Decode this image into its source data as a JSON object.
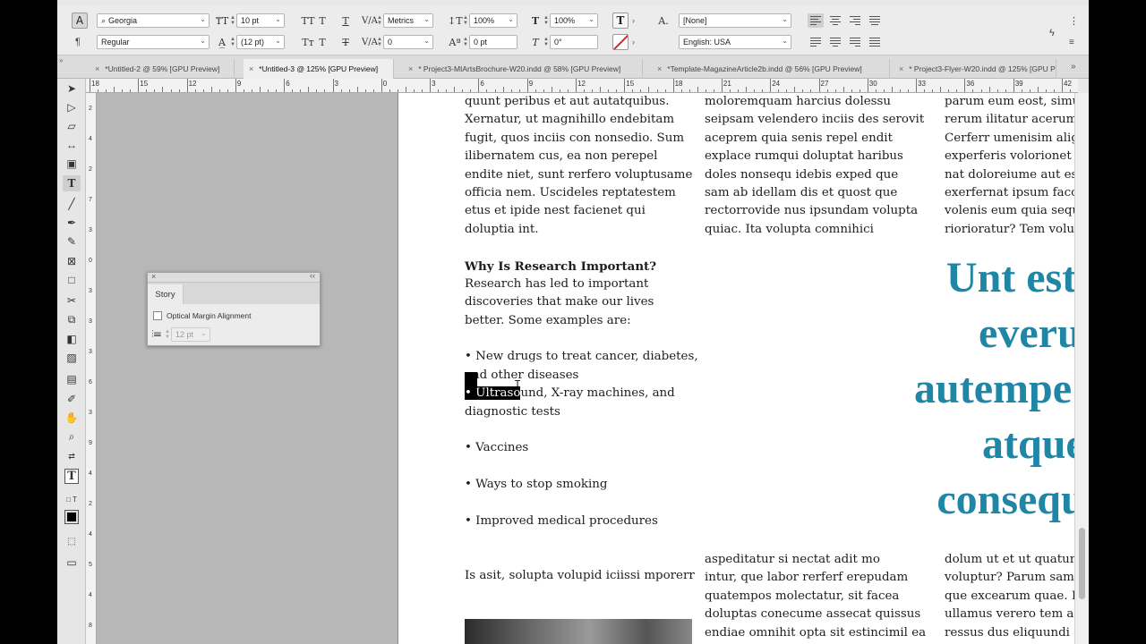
{
  "control_panel": {
    "font_family": "Georgia",
    "font_style": "Regular",
    "font_size": "10 pt",
    "leading": "(12 pt)",
    "kerning": "Metrics",
    "tracking": "0",
    "vertical_scale": "100%",
    "horizontal_scale": "100%",
    "baseline_shift": "0 pt",
    "skew": "0°",
    "char_style": "[None]",
    "language": "English: USA",
    "all_caps_label": "TT",
    "superscript_label": "T",
    "small_caps_label": "Tт",
    "subscript_label": "T",
    "char_style_icon": "A."
  },
  "tabs": [
    "*Untitled-2 @ 59% [GPU Preview]",
    "*Untitled-3 @ 125% [GPU Preview]",
    "* Project3-MIArtsBrochure-W20.indd @ 58% [GPU Preview]",
    "*Template-MagazineArticle2b.indd @ 56% [GPU Preview]",
    "* Project3-Flyer-W20.indd @ 125% [GPU P"
  ],
  "hruler_labels": [
    "18",
    "15",
    "12",
    "9",
    "6",
    "3",
    "0",
    "3",
    "6",
    "9",
    "12",
    "15",
    "18",
    "21",
    "24",
    "27",
    "30",
    "33",
    "36",
    "39",
    "42",
    "45",
    "48"
  ],
  "vruler_labels": [
    "2",
    "4",
    "2",
    "7",
    "3",
    "0",
    "3",
    "3",
    "3",
    "6",
    "3",
    "9",
    "4",
    "2",
    "4",
    "5",
    "4",
    "8"
  ],
  "story_panel": {
    "title": "Story",
    "option": "Optical Margin Alignment",
    "size": "12 pt"
  },
  "document": {
    "col1": [
      "quunt peribus et aut autatquibus.",
      "Xernatur, ut magnihillo endebitam",
      "fugit, quos inciis con nonsedio. Sum",
      "ilibernatem cus, ea non perepel",
      "endite niet, sunt rerfero voluptusame",
      "officia nem. Uscideles reptatestem",
      "etus et ipide nest facienet qui",
      "doluptia int."
    ],
    "heading": "Why Is Research Important?",
    "col1_b": [
      "Research has led to important",
      "discoveries that make our lives",
      "better. Some examples are:"
    ],
    "bullet1": [
      "• New drugs to treat cancer, diabetes,",
      "and other diseases"
    ],
    "bullet2_selected": "• Ultraso",
    "bullet2_rest": "und, X-ray machines, and",
    "bullet2_line2": "diagnostic tests",
    "bullet3": "• Vaccines",
    "bullet4": "• Ways to stop smoking",
    "bullet5": "• Improved medical procedures",
    "col1_end": "Is asit, solupta volupid iciissi mporerr",
    "col2": [
      "moloremquam harcius dolessu",
      "seipsam velendero inciis des serovit",
      "aceprem quia senis repel endit",
      "explace rumqui doluptat haribus",
      "doles nonsequ idebis exped que",
      "sam ab idellam dis et quost que",
      "rectorrovide nus ipsundam volupta",
      "quiac. Ita volupta comnihici"
    ],
    "col3": [
      "parum eum eost, simu",
      "rerum ilitatur acerum",
      "Cerferr umenisim alig",
      "experferis volorionet",
      "nat doloreiume aut es",
      "exerfernat ipsum facc",
      "volenis eum quia sequ",
      "riorioratur? Tem volu"
    ],
    "pullquote": [
      "Unt estiis qui n",
      "everum aut q",
      "autempe pa velic",
      "atque necessi",
      "consequ everun"
    ],
    "col2_b": [
      "aspeditatur si nectat adit mo",
      "intur, que labor rerferf erepudam",
      "quatempos molectatur, sit facea",
      "doluptas conecume assecat quissus",
      "endiae omnihit opta sit estincimil ea"
    ],
    "col3_b": [
      "dolum ut et ut quatur",
      "voluptur? Parum sam",
      "que excearum quae. I",
      "ullamus verero tem a",
      "ressus dus eliquundi"
    ]
  },
  "colors": {
    "pullquote": "#1f86a6",
    "pasteboard": "#b7b7b7",
    "panel": "#ececec"
  }
}
